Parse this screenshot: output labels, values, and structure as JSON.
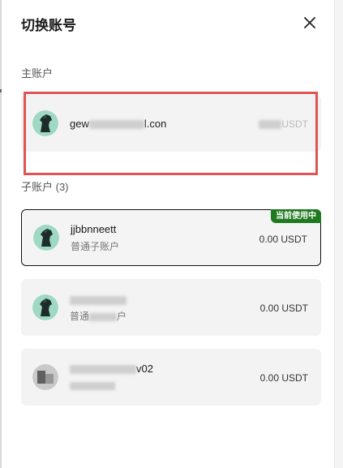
{
  "header": {
    "title": "切换账号"
  },
  "main_section": {
    "label": "主账户",
    "account": {
      "name_visible": "gew",
      "name_tail": "l.con",
      "balance_tail": "USDT"
    }
  },
  "sub_section": {
    "label": "子账户 (3)",
    "accounts": [
      {
        "name": "jjbbnneett",
        "type": "普通子账户",
        "balance": "0.00 USDT",
        "badge": "当前使用中"
      },
      {
        "name": "",
        "type": "普通",
        "type_tail": "户",
        "balance": "0.00 USDT"
      },
      {
        "name_tail": "v02",
        "balance": "0.00 USDT"
      }
    ]
  },
  "colors": {
    "accent_red": "#e05454",
    "badge_green": "#1f7a1f"
  },
  "icons": {
    "close": "close-icon",
    "avatar": "horse-avatar-icon"
  }
}
